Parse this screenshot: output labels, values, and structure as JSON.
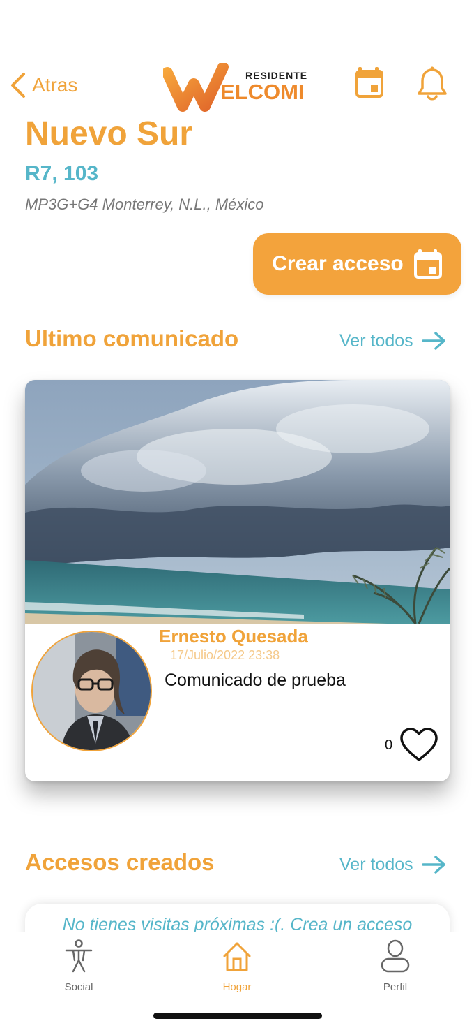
{
  "header": {
    "back_label": "Atras",
    "logo_top": "RESIDENTE",
    "logo_main": "ELCOMI",
    "icons": {
      "back": "chevron-left-icon",
      "calendar": "calendar-icon",
      "bell": "bell-icon"
    }
  },
  "property": {
    "name": "Nuevo Sur",
    "unit": "R7, 103",
    "address": "MP3G+G4 Monterrey, N.L., México"
  },
  "create_access": {
    "label": "Crear acceso",
    "icon": "calendar-icon"
  },
  "last_announcement": {
    "title": "Ultimo comunicado",
    "see_all": "Ver todos",
    "post": {
      "author": "Ernesto Quesada",
      "date": "17/Julio/2022 23:38",
      "text": "Comunicado de prueba",
      "likes": "0",
      "image": "storm-cloud-over-beach-photo"
    }
  },
  "access_created": {
    "title": "Accesos creados",
    "see_all": "Ver todos",
    "empty_message": "No tienes visitas próximas :(. Crea un acceso"
  },
  "tabbar": {
    "items": [
      {
        "label": "Social",
        "icon": "person-accessibility-icon",
        "active": false
      },
      {
        "label": "Hogar",
        "icon": "home-icon",
        "active": true
      },
      {
        "label": "Perfil",
        "icon": "user-icon",
        "active": false
      }
    ]
  },
  "colors": {
    "accent_orange": "#f0a33a",
    "accent_teal": "#56b6c9",
    "gray_text": "#777777"
  }
}
